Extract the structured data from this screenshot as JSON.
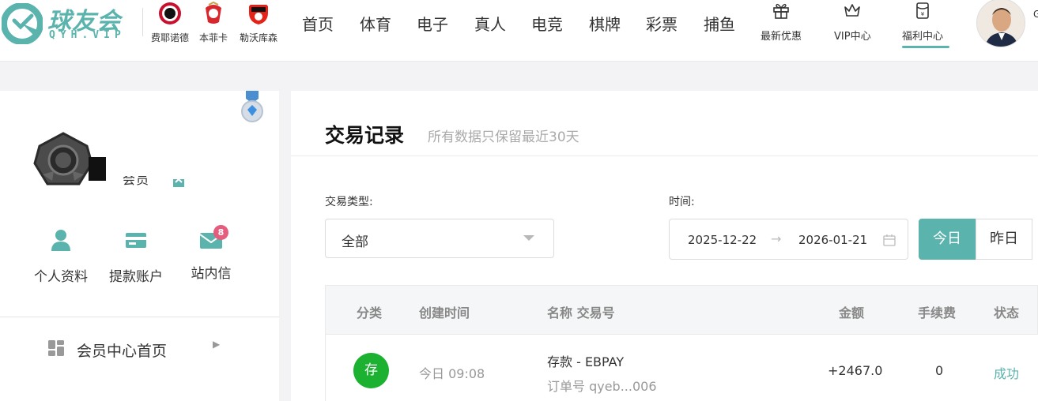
{
  "brand": {
    "name": "球友会",
    "sub": "QYH.VIP",
    "accent": "#5bb3ad"
  },
  "clubs": [
    {
      "name": "费耶诺德",
      "color": "#c8102e"
    },
    {
      "name": "本菲卡",
      "color": "#d7262c"
    },
    {
      "name": "勒沃库森",
      "color": "#e32219"
    }
  ],
  "nav": [
    "首页",
    "体育",
    "电子",
    "真人",
    "电竞",
    "棋牌",
    "彩票",
    "捕鱼"
  ],
  "promos": [
    {
      "label": "最新优惠",
      "icon": "gift-icon"
    },
    {
      "label": "VIP中心",
      "icon": "crown-icon"
    },
    {
      "label": "福利中心",
      "icon": "red-packet-icon",
      "active": true
    }
  ],
  "header_edge_text": "G",
  "sidebar": {
    "level_text": "会员",
    "quick_links": [
      {
        "label": "个人资料",
        "icon": "user-icon"
      },
      {
        "label": "提款账户",
        "icon": "card-icon"
      },
      {
        "label": "站内信",
        "icon": "mail-icon",
        "badge": "8"
      }
    ],
    "menu": [
      {
        "label": "会员中心首页",
        "icon": "dashboard-icon"
      }
    ]
  },
  "main": {
    "title": "交易记录",
    "subtitle": "所有数据只保留最近30天",
    "filters": {
      "type_label": "交易类型:",
      "type_value": "全部",
      "time_label": "时间:",
      "date_from": "2025-12-22",
      "date_to": "2026-01-21",
      "quick_buttons": [
        "今日",
        "昨日"
      ]
    },
    "table": {
      "headers": [
        "分类",
        "创建时间",
        "名称 交易号",
        "金额",
        "手续费",
        "状态"
      ],
      "rows": [
        {
          "category": "存",
          "created": "今日 09:08",
          "name": "存款 - EBPAY",
          "order_no": "订单号 qyeb...006",
          "amount": "+2467.0",
          "fee": "0",
          "status": "成功"
        }
      ]
    }
  }
}
